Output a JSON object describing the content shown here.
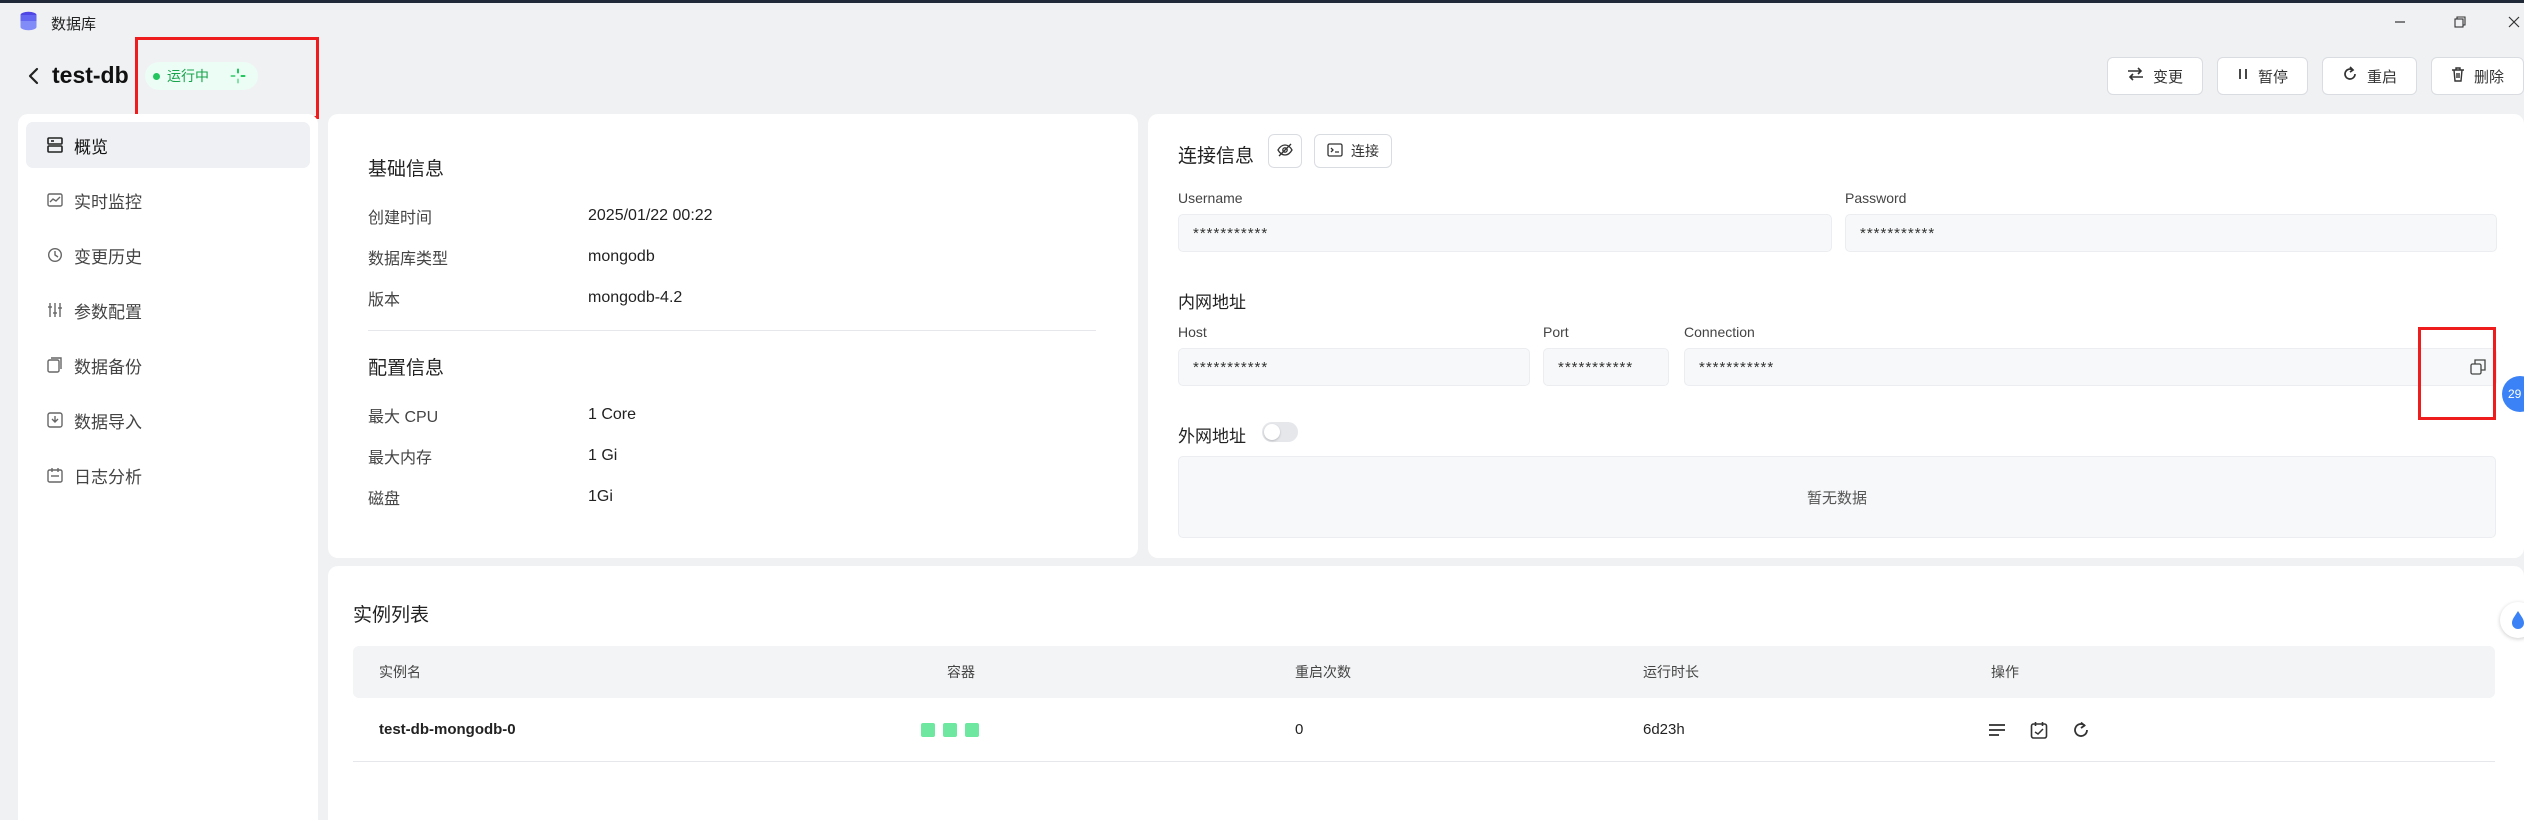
{
  "window": {
    "title": "数据库",
    "minimize_icon": "minimize-icon",
    "restore_icon": "restore-icon",
    "close_icon": "close-icon"
  },
  "header": {
    "name": "test-db",
    "status": "运行中",
    "actions": [
      {
        "label": "变更",
        "icon": "swap-icon"
      },
      {
        "label": "暂停",
        "icon": "pause-icon"
      },
      {
        "label": "重启",
        "icon": "restart-icon"
      },
      {
        "label": "删除",
        "icon": "trash-icon"
      }
    ]
  },
  "sidebar": {
    "items": [
      {
        "label": "概览",
        "icon": "overview-icon",
        "active": true
      },
      {
        "label": "实时监控",
        "icon": "monitor-icon"
      },
      {
        "label": "变更历史",
        "icon": "history-icon"
      },
      {
        "label": "参数配置",
        "icon": "sliders-icon"
      },
      {
        "label": "数据备份",
        "icon": "backup-icon"
      },
      {
        "label": "数据导入",
        "icon": "import-icon"
      },
      {
        "label": "日志分析",
        "icon": "calendar-icon"
      }
    ]
  },
  "basic": {
    "title": "基础信息",
    "rows": [
      {
        "label": "创建时间",
        "value": "2025/01/22 00:22"
      },
      {
        "label": "数据库类型",
        "value": "mongodb"
      },
      {
        "label": "版本",
        "value": "mongodb-4.2"
      }
    ],
    "config_title": "配置信息",
    "config_rows": [
      {
        "label": "最大 CPU",
        "value": "1 Core"
      },
      {
        "label": "最大内存",
        "value": "1 Gi"
      },
      {
        "label": "磁盘",
        "value": "1Gi"
      }
    ]
  },
  "connection": {
    "title": "连接信息",
    "connect_label": "连接",
    "username_label": "Username",
    "username_value": "***********",
    "password_label": "Password",
    "password_value": "***********",
    "internal_title": "内网地址",
    "host_label": "Host",
    "host_value": "***********",
    "port_label": "Port",
    "port_value": "***********",
    "connection_label": "Connection",
    "connection_value": "***********",
    "external_title": "外网地址",
    "external_enabled": false,
    "empty_text": "暂无数据"
  },
  "instances": {
    "title": "实例列表",
    "columns": [
      "实例名",
      "容器",
      "重启次数",
      "运行时长",
      "操作"
    ],
    "rows": [
      {
        "name": "test-db-mongodb-0",
        "containers": 3,
        "restarts": "0",
        "uptime": "6d23h"
      }
    ]
  },
  "floating": {
    "badge": "29"
  }
}
